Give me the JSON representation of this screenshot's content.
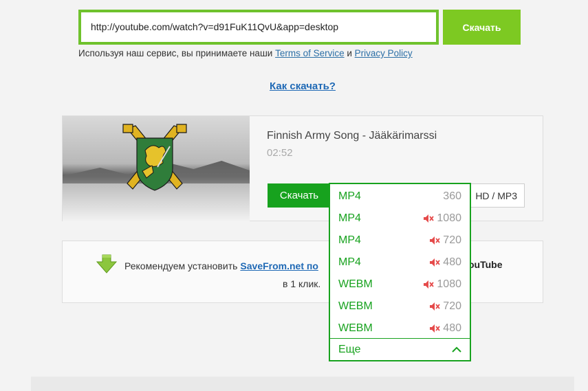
{
  "search": {
    "url_value": "http://youtube.com/watch?v=d91FuK11QvU&app=desktop",
    "download_label": "Скачать"
  },
  "terms": {
    "prefix": "Используя наш сервис, вы принимаете наши ",
    "tos_link": "Terms of Service",
    "and": " и ",
    "privacy_link": "Privacy Policy"
  },
  "howto": {
    "label": "Как скачать?"
  },
  "video": {
    "title": "Finnish Army Song - Jääkärimarssi",
    "duration": "02:52",
    "download_label": "Скачать",
    "hd_label": "HD / MP3"
  },
  "recommend": {
    "prefix": "Рекомендуем установить ",
    "link": "SaveFrom.net по",
    "tail": "ouTube",
    "line2": "в 1 клик."
  },
  "dropdown": {
    "items": [
      {
        "format": "MP4",
        "quality": "360",
        "muted": false
      },
      {
        "format": "MP4",
        "quality": "1080",
        "muted": true
      },
      {
        "format": "MP4",
        "quality": "720",
        "muted": true
      },
      {
        "format": "MP4",
        "quality": "480",
        "muted": true
      },
      {
        "format": "WEBM",
        "quality": "1080",
        "muted": true
      },
      {
        "format": "WEBM",
        "quality": "720",
        "muted": true
      },
      {
        "format": "WEBM",
        "quality": "480",
        "muted": true
      }
    ],
    "more_label": "Еще"
  },
  "icons": {
    "mute": "speaker-muted-icon",
    "more": "chevron-up-icon",
    "recommend": "download-arrow-icon"
  },
  "colors": {
    "accent_green": "#7dc922",
    "button_green": "#17a21e",
    "link_blue": "#1f69b5",
    "mute_red": "#e54b4b"
  }
}
